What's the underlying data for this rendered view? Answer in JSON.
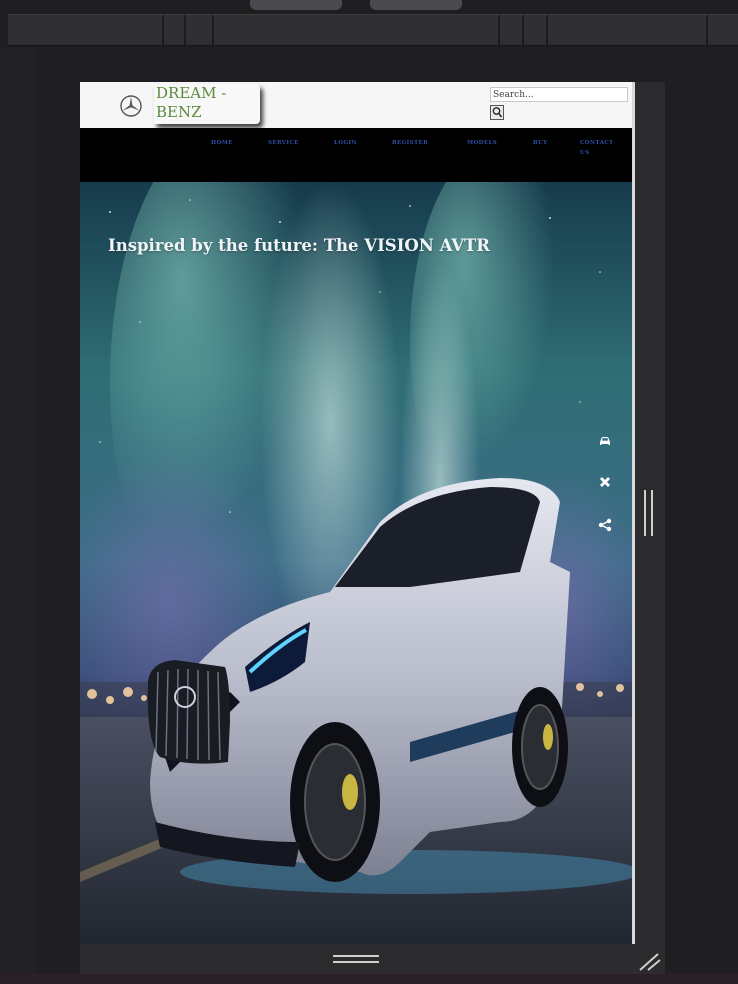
{
  "site": {
    "brand_line1": "DREAM -",
    "brand_line2": "BENZ",
    "logo_icon": "mercedes-star-icon",
    "brand_color": "#5c8a3c"
  },
  "search": {
    "placeholder": "Search...",
    "button_icon": "search-icon"
  },
  "nav": {
    "items": [
      {
        "label": "HOME"
      },
      {
        "label": "SERVICE"
      },
      {
        "label": "LOGIN"
      },
      {
        "label": "REGISTER"
      },
      {
        "label": "MODELS"
      },
      {
        "label": "BUY"
      },
      {
        "label": "CONTACT US"
      }
    ],
    "link_color": "#2f4fa6"
  },
  "hero": {
    "title": "Inspired by the future: The VISION AVTR"
  },
  "side_icons": [
    {
      "icon": "car-icon"
    },
    {
      "icon": "tools-icon"
    },
    {
      "icon": "share-icon"
    }
  ]
}
